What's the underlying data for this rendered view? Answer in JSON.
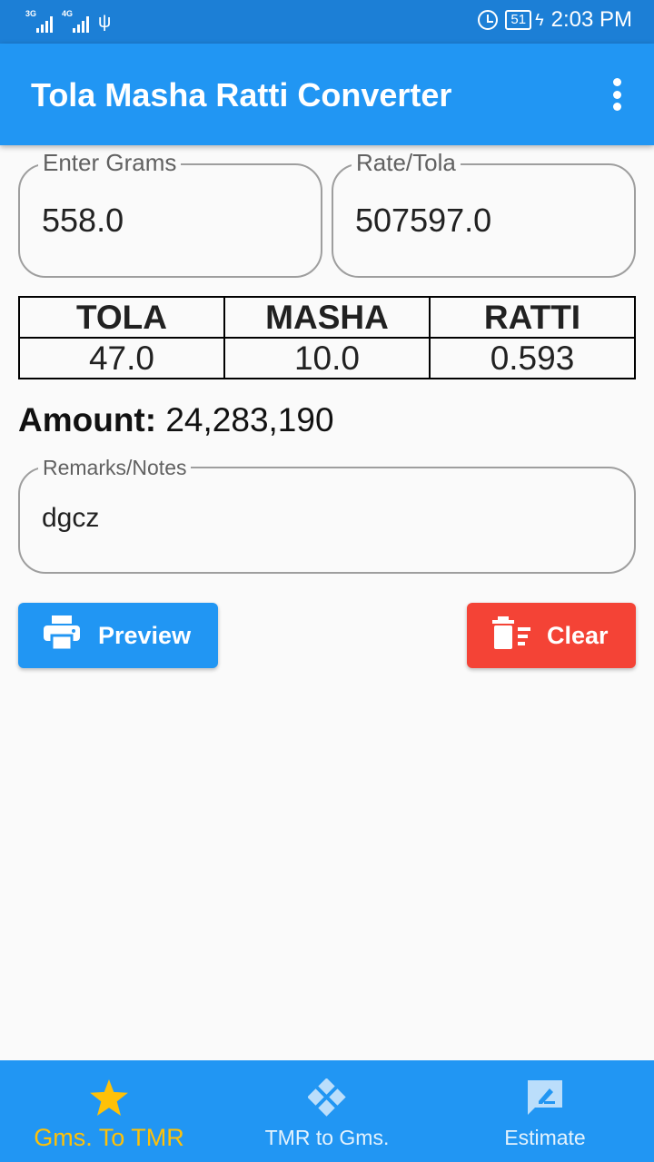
{
  "status_bar": {
    "network_1": "3G",
    "network_2": "4G",
    "battery": "51",
    "time": "2:03 PM"
  },
  "app_bar": {
    "title": "Tola Masha Ratti Converter"
  },
  "inputs": {
    "grams": {
      "label": "Enter Grams",
      "value": "558.0"
    },
    "rate": {
      "label": "Rate/Tola",
      "value": "507597.0"
    }
  },
  "table": {
    "headers": [
      "TOLA",
      "MASHA",
      "RATTI"
    ],
    "values": [
      "47.0",
      "10.0",
      "0.593"
    ]
  },
  "amount": {
    "label": "Amount:",
    "value": "24,283,190"
  },
  "notes": {
    "label": "Remarks/Notes",
    "value": "dgcz"
  },
  "buttons": {
    "preview": "Preview",
    "clear": "Clear"
  },
  "bottom_nav": {
    "items": [
      {
        "label": "Gms. To TMR",
        "icon": "star-icon",
        "active": true
      },
      {
        "label": "TMR to Gms.",
        "icon": "diamond-icon",
        "active": false
      },
      {
        "label": "Estimate",
        "icon": "estimate-icon",
        "active": false
      }
    ]
  },
  "colors": {
    "primary": "#2196f3",
    "status_bar": "#1c7fd6",
    "clear_button": "#f44336",
    "active_nav": "#ffc107"
  }
}
